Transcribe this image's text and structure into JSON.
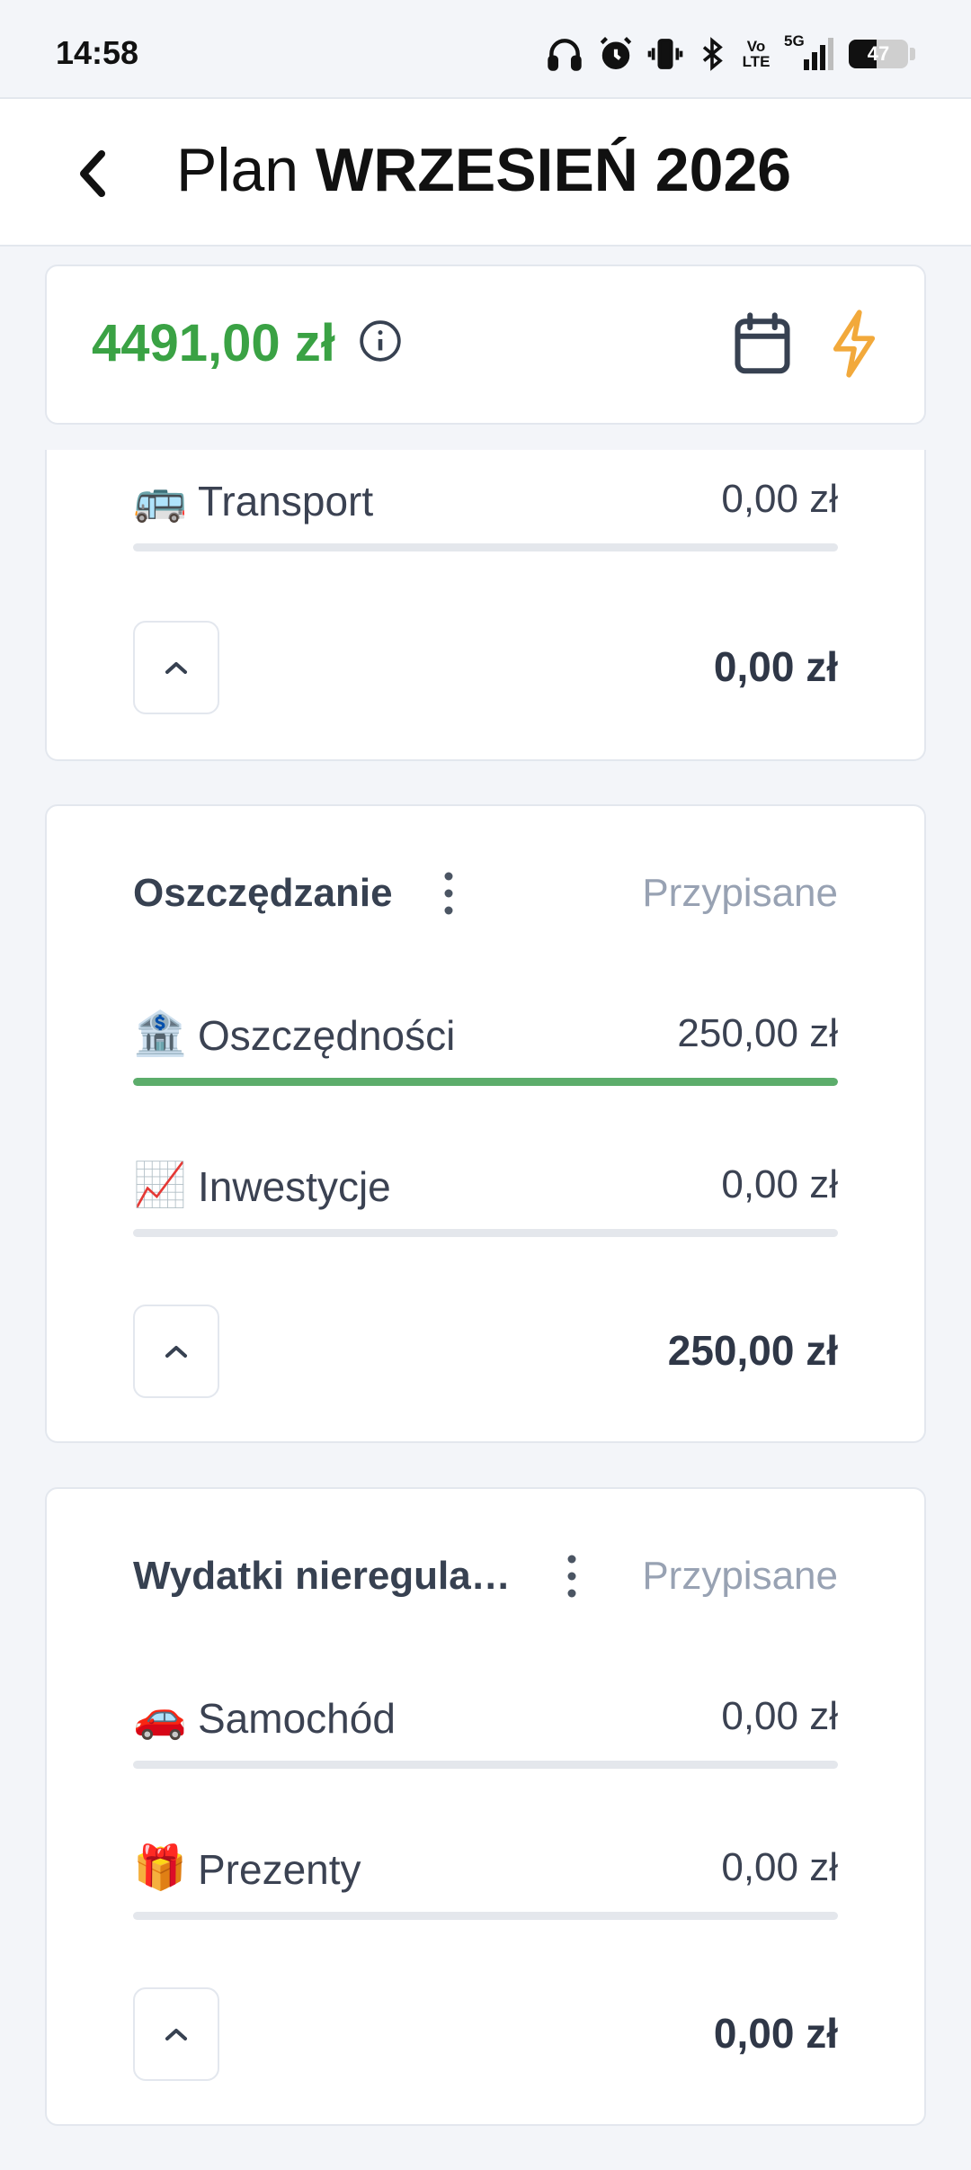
{
  "status_bar": {
    "time": "14:58",
    "icons": [
      "headphones-icon",
      "alarm-icon",
      "vibrate-icon",
      "bluetooth-icon",
      "volte-icon",
      "signal-5g-icon"
    ],
    "volte_text": "Vo LTE",
    "network_text": "5G",
    "battery_level": "47",
    "battery_fraction": 0.47
  },
  "header": {
    "title_prefix": "Plan",
    "title_month": "WRZESIEŃ 2026"
  },
  "balance": {
    "amount": "4491,00 zł",
    "color": "#3aa244",
    "accent_bolt_color": "#f2a93b"
  },
  "groups": [
    {
      "title": "",
      "assigned_label": "",
      "items": [
        {
          "emoji": "🚌",
          "name": "Transport",
          "amount": "0,00 zł",
          "progress": 0
        }
      ],
      "total": "0,00 zł"
    },
    {
      "title": "Oszczędzanie",
      "assigned_label": "Przypisane",
      "items": [
        {
          "emoji": "🏦",
          "name": "Oszczędności",
          "amount": "250,00 zł",
          "progress": 1
        },
        {
          "emoji": "📈",
          "name": "Inwestycje",
          "amount": "0,00 zł",
          "progress": 0
        }
      ],
      "total": "250,00 zł"
    },
    {
      "title": "Wydatki nieregularne",
      "assigned_label": "Przypisane",
      "items": [
        {
          "emoji": "🚗",
          "name": "Samochód",
          "amount": "0,00 zł",
          "progress": 0
        },
        {
          "emoji": "🎁",
          "name": "Prezenty",
          "amount": "0,00 zł",
          "progress": 0
        }
      ],
      "total": "0,00 zł"
    }
  ]
}
